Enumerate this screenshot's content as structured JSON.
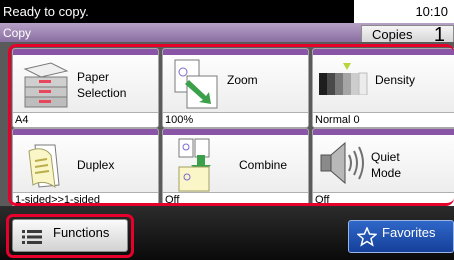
{
  "status": {
    "message": "Ready to copy.",
    "time": "10:10"
  },
  "mode": {
    "title": "Copy",
    "copies_label": "Copies",
    "copies_value": "1"
  },
  "tiles": [
    {
      "label": "Paper\nSelection",
      "value": "A4",
      "icon": "paper-tray-icon"
    },
    {
      "label": "Zoom",
      "value": "100%",
      "icon": "zoom-icon"
    },
    {
      "label": "Density",
      "value": "Normal 0",
      "icon": "density-icon"
    },
    {
      "label": "Duplex",
      "value": "1-sided>>1-sided",
      "icon": "duplex-icon"
    },
    {
      "label": "Combine",
      "value": "Off",
      "icon": "combine-icon"
    },
    {
      "label": "Quiet\nMode",
      "value": "Off",
      "icon": "speaker-icon"
    }
  ],
  "bottom": {
    "functions_label": "Functions",
    "favorites_label": "Favorites"
  },
  "colors": {
    "accent_purple": "#8a55a6",
    "highlight_red": "#e8002d",
    "favorites_blue": "#2f67c8"
  }
}
